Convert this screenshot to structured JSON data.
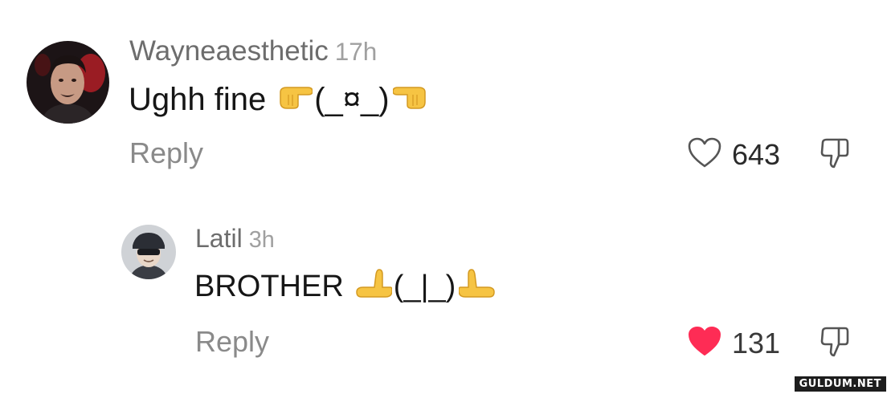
{
  "comments": [
    {
      "username": "Wayneaesthetic",
      "time": "17h",
      "text": "Ughh fine",
      "face": "(_¤_)",
      "reply_label": "Reply",
      "likes": "643",
      "liked": false,
      "avatar_icon": "user-photo-avatar",
      "left_hand_icon": "pointing-right-hand-icon",
      "right_hand_icon": "pointing-left-hand-icon"
    },
    {
      "username": "Latil",
      "time": "3h",
      "text": "BROTHER",
      "face": "(_|_)",
      "reply_label": "Reply",
      "likes": "131",
      "liked": true,
      "avatar_icon": "user-cartoon-avatar",
      "left_hand_icon": "palm-up-hand-icon",
      "right_hand_icon": "palm-up-hand-icon"
    }
  ],
  "colors": {
    "liked_heart": "#fe2c55",
    "username": "#6d6d6d",
    "reply": "#8a8a8a",
    "emoji_yellow": "#f6c443"
  },
  "watermark": "GULDUM.NET"
}
